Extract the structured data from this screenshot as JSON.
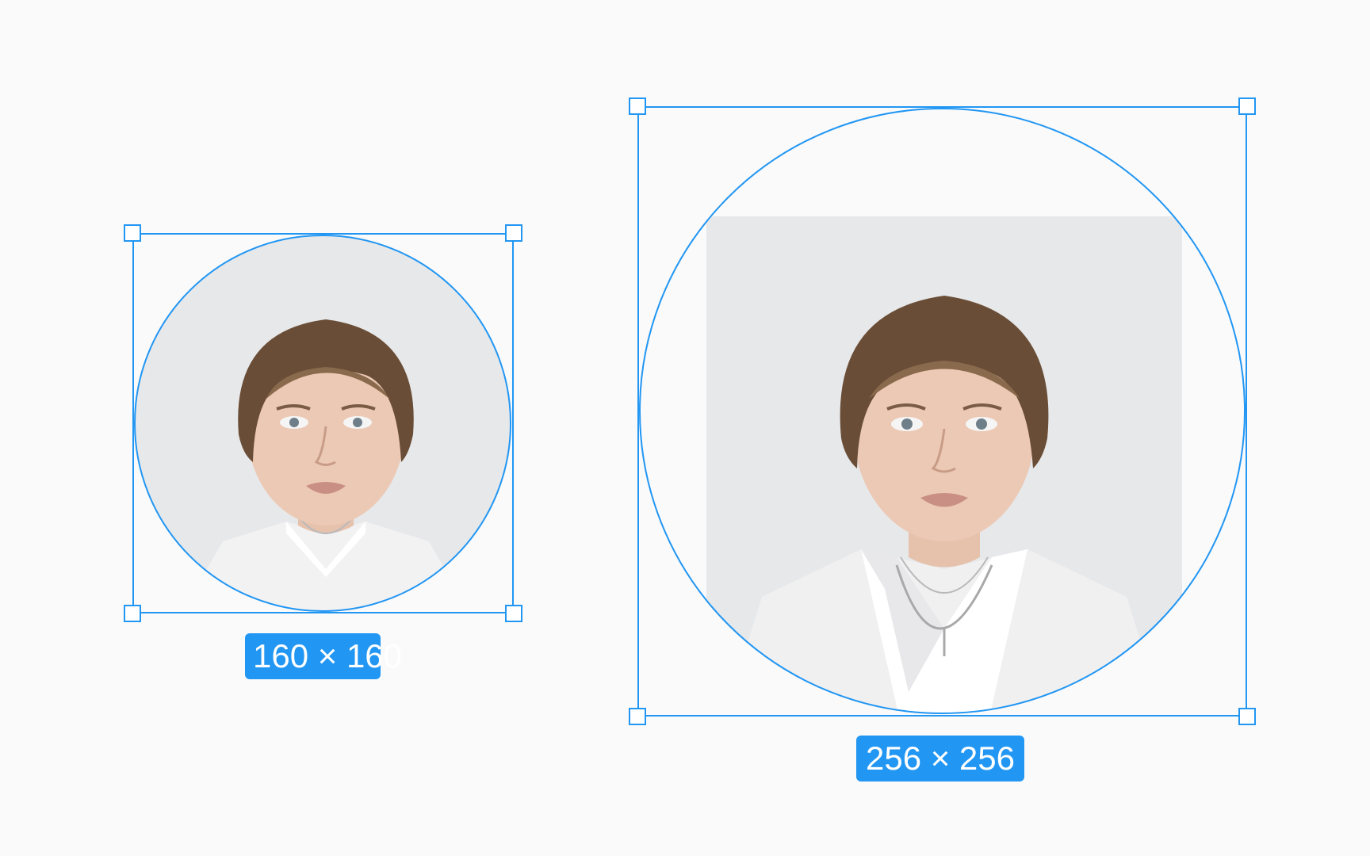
{
  "avatars": [
    {
      "id": "small",
      "size_label": "160 × 160"
    },
    {
      "id": "large",
      "size_label": "256 × 256"
    }
  ],
  "colors": {
    "selection": "#2196f3",
    "background": "#fafafa",
    "badge_text": "#ffffff"
  },
  "icons": [
    "resize-handle-icon"
  ]
}
